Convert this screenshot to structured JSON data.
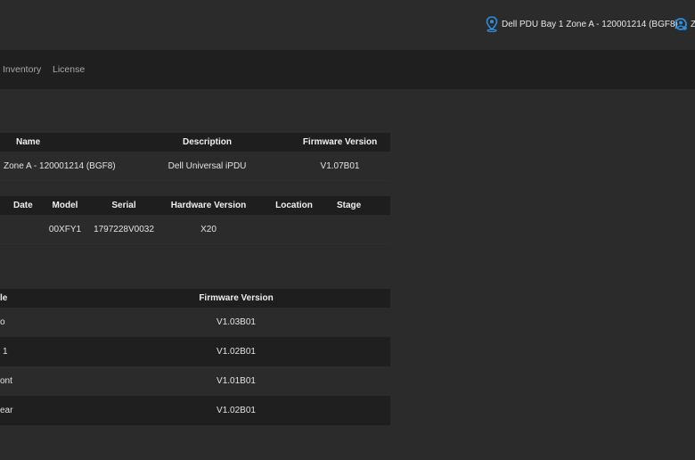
{
  "header": {
    "device_name": "Dell PDU Bay 1 Zone A - 120001214 (BGF8)",
    "user_initial": "Z"
  },
  "nav": {
    "items": [
      "Inventory",
      "License"
    ]
  },
  "device_table": {
    "columns": [
      "Name",
      "Description",
      "Firmware Version"
    ],
    "rows": [
      {
        "name": "Zone A - 120001214 (BGF8)",
        "description": "Dell Universal iPDU",
        "firmware": "V1.07B01"
      }
    ]
  },
  "hardware_table": {
    "columns": [
      "Date",
      "Model",
      "Serial",
      "Hardware Version",
      "Location",
      "Stage"
    ],
    "rows": [
      {
        "date": "",
        "model": "00XFY1",
        "serial": "1797228V0032",
        "hardware_version": "X20",
        "location": "",
        "stage": ""
      }
    ]
  },
  "module_table": {
    "columns": [
      "le",
      "Firmware Version"
    ],
    "rows": [
      {
        "module": "o",
        "firmware": "V1.03B01"
      },
      {
        "module": "1",
        "firmware": "V1.02B01"
      },
      {
        "module": "ont",
        "firmware": "V1.01B01"
      },
      {
        "module": "ear",
        "firmware": "V1.02B01"
      }
    ]
  },
  "colors": {
    "background": "#2b2b2b",
    "header_row": "#1e1e1e",
    "accent_blue": "#2f8ddc"
  }
}
